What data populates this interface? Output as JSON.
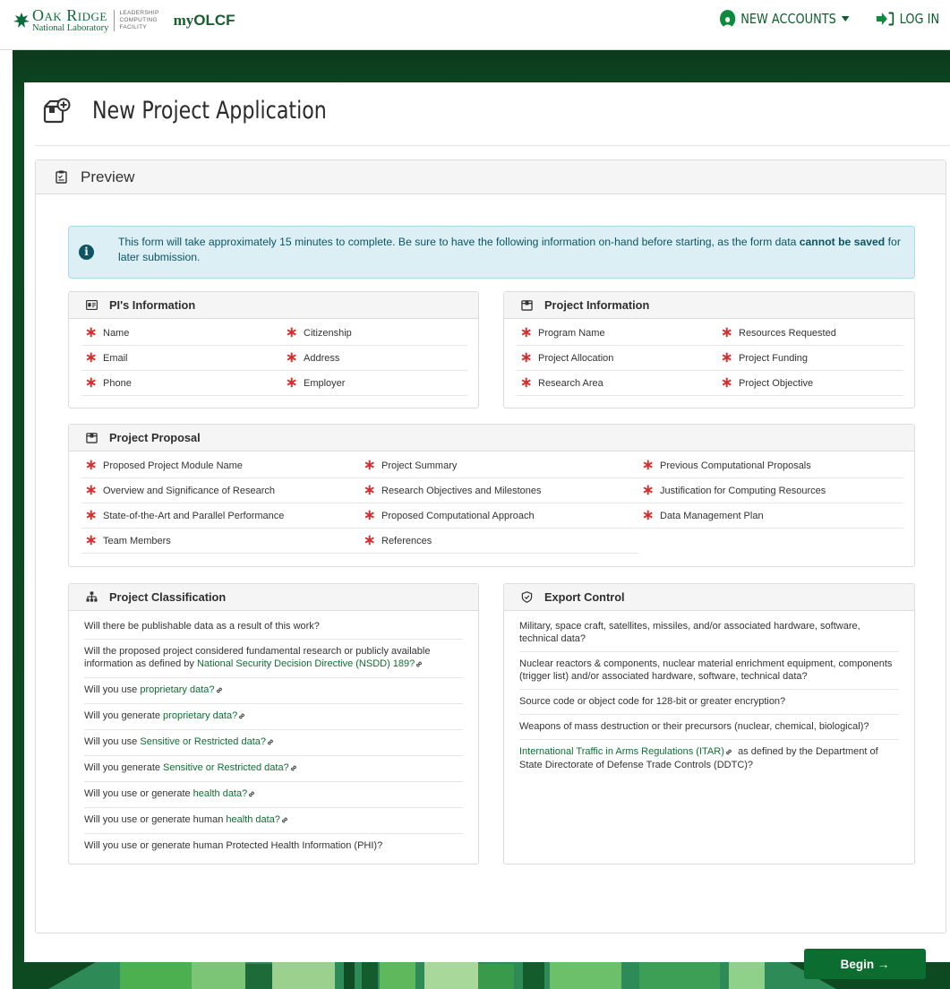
{
  "header": {
    "org_name": "Oak Ridge",
    "org_sub": "National Laboratory",
    "facility": [
      "LEADERSHIP",
      "COMPUTING",
      "FACILITY"
    ],
    "app_prefix": "my",
    "app_name": "OLCF",
    "new_accounts_label": "NEW ACCOUNTS",
    "login_label": "LOG IN"
  },
  "page": {
    "title": "New Project Application",
    "preview_label": "Preview"
  },
  "alert": {
    "text_before": "This form will take approximately 15 minutes to complete. Be sure to have the following information on-hand before starting, as the form data ",
    "text_bold": "cannot be saved",
    "text_after": " for later submission."
  },
  "pi_info": {
    "title": "PI's Information",
    "items": [
      "Name",
      "Citizenship",
      "Email",
      "Address",
      "Phone",
      "Employer"
    ]
  },
  "project_info": {
    "title": "Project Information",
    "items": [
      "Program Name",
      "Resources Requested",
      "Project Allocation",
      "Project Funding",
      "Research Area",
      "Project Objective"
    ]
  },
  "project_proposal": {
    "title": "Project Proposal",
    "items": [
      "Proposed Project Module Name",
      "Project Summary",
      "Previous Computational Proposals",
      "Overview and Significance of Research",
      "Research Objectives and Milestones",
      "Justification for Computing Resources",
      "State-of-the-Art and Parallel Performance",
      "Proposed Computational Approach",
      "Data Management Plan",
      "Team Members",
      "References"
    ]
  },
  "classification": {
    "title": "Project Classification",
    "questions": [
      {
        "pre": "Will there be publishable data as a result of this work?",
        "link": "",
        "post": ""
      },
      {
        "pre": "Will the proposed project considered fundamental research or publicly available information as defined by ",
        "link": "National Security Decision Directive (NSDD) 189?",
        "post": ""
      },
      {
        "pre": "Will you use ",
        "link": "proprietary data?",
        "post": ""
      },
      {
        "pre": "Will you generate ",
        "link": "proprietary data?",
        "post": ""
      },
      {
        "pre": "Will you use ",
        "link": "Sensitive or Restricted data?",
        "post": ""
      },
      {
        "pre": "Will you generate ",
        "link": "Sensitive or Restricted data?",
        "post": ""
      },
      {
        "pre": "Will you use or generate ",
        "link": "health data?",
        "post": ""
      },
      {
        "pre": "Will you use or generate human ",
        "link": "health data?",
        "post": ""
      },
      {
        "pre": "Will you use or generate human Protected Health Information (PHI)?",
        "link": "",
        "post": ""
      }
    ]
  },
  "export_control": {
    "title": "Export Control",
    "questions": [
      {
        "pre": "Military, space craft, satellites, missiles, and/or associated hardware, software, technical data?",
        "link": "",
        "post": ""
      },
      {
        "pre": "Nuclear reactors & components, nuclear material enrichment equipment, components (trigger list) and/or associated hardware, software, technical data?",
        "link": "",
        "post": ""
      },
      {
        "pre": "Source code or object code for 128-bit or greater encryption?",
        "link": "",
        "post": ""
      },
      {
        "pre": "Weapons of mass destruction or their precursors (nuclear, chemical, biological)?",
        "link": "",
        "post": ""
      },
      {
        "pre": "",
        "link": "International Traffic in Arms Regulations (ITAR)",
        "post": "  as defined by the Department of State Directorate of Defense Trade Controls (DDTC)?"
      }
    ]
  },
  "actions": {
    "begin_label": "Begin →"
  },
  "colors": {
    "brand_green": "#0b6e30",
    "required_star": "#d32f2f",
    "alert_bg": "#dbeff5",
    "link": "#0f6e33"
  },
  "icons": {
    "new_project": "new-project-icon",
    "preview": "clipboard-icon",
    "pi": "id-card-icon",
    "project_info": "box-icon",
    "proposal": "box-icon",
    "classification": "sitemap-icon",
    "export": "shield-icon",
    "chain": "link-icon"
  }
}
